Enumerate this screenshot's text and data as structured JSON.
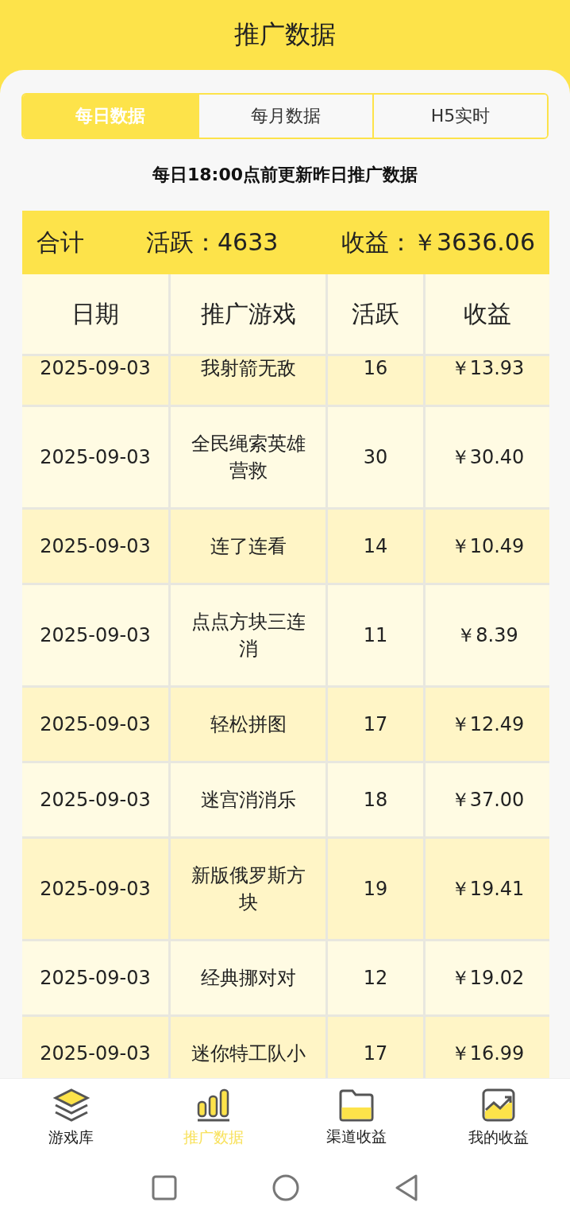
{
  "header": {
    "title": "推广数据"
  },
  "tabs": [
    {
      "label": "每日数据",
      "selected": true
    },
    {
      "label": "每月数据",
      "selected": false
    },
    {
      "label": "H5实时",
      "selected": false
    }
  ],
  "notice": "每日18:00点前更新昨日推广数据",
  "summary": {
    "label": "合计",
    "active": "活跃：4633",
    "income": "收益：￥3636.06"
  },
  "table": {
    "columns": [
      "日期",
      "推广游戏",
      "活跃",
      "收益"
    ],
    "rows": [
      {
        "date": "2025-09-03",
        "game": "我射箭无敌",
        "active": "16",
        "income": "￥13.93"
      },
      {
        "date": "2025-09-03",
        "game": "全民绳索英雄营救",
        "active": "30",
        "income": "￥30.40"
      },
      {
        "date": "2025-09-03",
        "game": "连了连看",
        "active": "14",
        "income": "￥10.49"
      },
      {
        "date": "2025-09-03",
        "game": "点点方块三连消",
        "active": "11",
        "income": "￥8.39"
      },
      {
        "date": "2025-09-03",
        "game": "轻松拼图",
        "active": "17",
        "income": "￥12.49"
      },
      {
        "date": "2025-09-03",
        "game": "迷宫消消乐",
        "active": "18",
        "income": "￥37.00"
      },
      {
        "date": "2025-09-03",
        "game": "新版俄罗斯方块",
        "active": "19",
        "income": "￥19.41"
      },
      {
        "date": "2025-09-03",
        "game": "经典挪对对",
        "active": "12",
        "income": "￥19.02"
      },
      {
        "date": "2025-09-03",
        "game": "迷你特工队小",
        "active": "17",
        "income": "￥16.99"
      }
    ]
  },
  "bottom_nav": [
    {
      "label": "游戏库",
      "selected": false
    },
    {
      "label": "推广数据",
      "selected": true
    },
    {
      "label": "渠道收益",
      "selected": false
    },
    {
      "label": "我的收益",
      "selected": false
    }
  ]
}
